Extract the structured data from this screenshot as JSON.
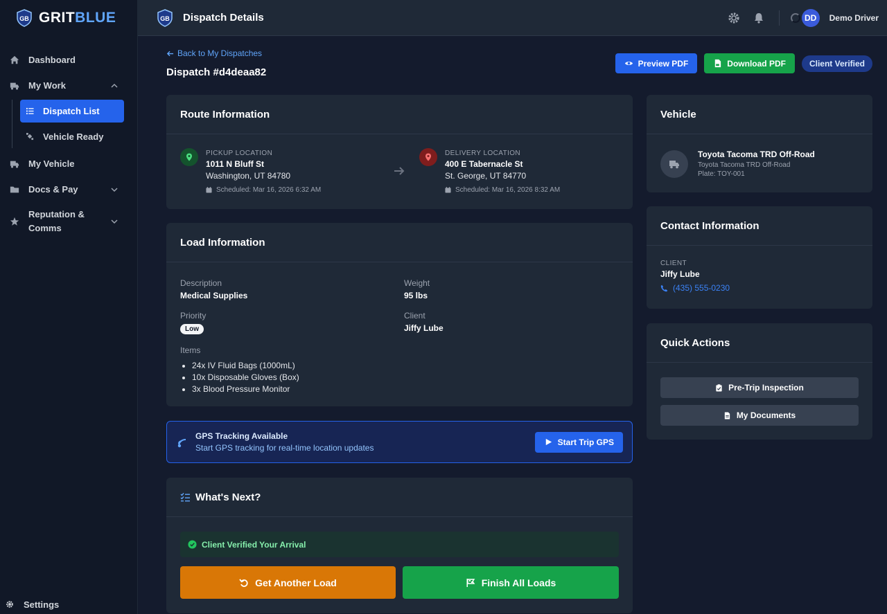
{
  "brand": {
    "logo_glyph": "GB",
    "name_part1": "GRIT",
    "name_part2": "BLUE"
  },
  "sidebar": {
    "dashboard": "Dashboard",
    "my_work": "My Work",
    "dispatch_list": "Dispatch List",
    "vehicle_ready": "Vehicle Ready",
    "my_vehicle": "My Vehicle",
    "docs_pay": "Docs & Pay",
    "reputation": "Reputation & Comms",
    "settings": "Settings"
  },
  "topbar": {
    "title": "Dispatch Details",
    "avatar_initials": "DD",
    "user_name": "Demo Driver"
  },
  "header": {
    "back_link": "Back to My Dispatches",
    "dispatch_id": "Dispatch #d4deaa82",
    "preview_pdf": "Preview PDF",
    "download_pdf": "Download PDF",
    "status_badge": "Client Verified"
  },
  "route": {
    "title": "Route Information",
    "pickup": {
      "label": "PICKUP LOCATION",
      "address": "1011 N Bluff St",
      "city": "Washington, UT 84780",
      "scheduled": "Scheduled: Mar 16, 2026 6:32 AM"
    },
    "delivery": {
      "label": "DELIVERY LOCATION",
      "address": "400 E Tabernacle St",
      "city": "St. George, UT 84770",
      "scheduled": "Scheduled: Mar 16, 2026 8:32 AM"
    }
  },
  "load": {
    "title": "Load Information",
    "description_label": "Description",
    "description_value": "Medical Supplies",
    "weight_label": "Weight",
    "weight_value": "95 lbs",
    "priority_label": "Priority",
    "priority_value": "Low",
    "client_label": "Client",
    "client_value": "Jiffy Lube",
    "items_label": "Items",
    "items": [
      "24x IV Fluid Bags (1000mL)",
      "10x Disposable Gloves (Box)",
      "3x Blood Pressure Monitor"
    ]
  },
  "gps": {
    "title": "GPS Tracking Available",
    "subtitle": "Start GPS tracking for real-time location updates",
    "button": "Start Trip GPS"
  },
  "next": {
    "title": "What's Next?",
    "verified": "Client Verified Your Arrival",
    "get_another": "Get Another Load",
    "finish_all": "Finish All Loads"
  },
  "vehicle": {
    "title": "Vehicle",
    "name": "Toyota Tacoma TRD Off-Road",
    "model": "Toyota Tacoma TRD Off-Road",
    "plate": "Plate: TOY-001"
  },
  "contact": {
    "title": "Contact Information",
    "label": "CLIENT",
    "name": "Jiffy Lube",
    "phone": "(435) 555-0230"
  },
  "quick_actions": {
    "title": "Quick Actions",
    "pretrip": "Pre-Trip Inspection",
    "documents": "My Documents"
  },
  "colors": {
    "primary": "#2563eb",
    "success": "#16a34a",
    "warning": "#d97706",
    "background": "#141b2d",
    "card": "#1f2937"
  },
  "icons": [
    "home-icon",
    "truck-icon",
    "list-icon",
    "satellite-icon",
    "folder-icon",
    "star-icon",
    "gear-icon",
    "bell-icon",
    "eye-icon",
    "file-pdf-icon",
    "map-pin-icon",
    "calendar-icon",
    "arrow-right-icon",
    "check-circle-icon",
    "undo-icon",
    "flag-icon",
    "phone-icon",
    "clipboard-icon",
    "document-icon",
    "play-icon"
  ]
}
